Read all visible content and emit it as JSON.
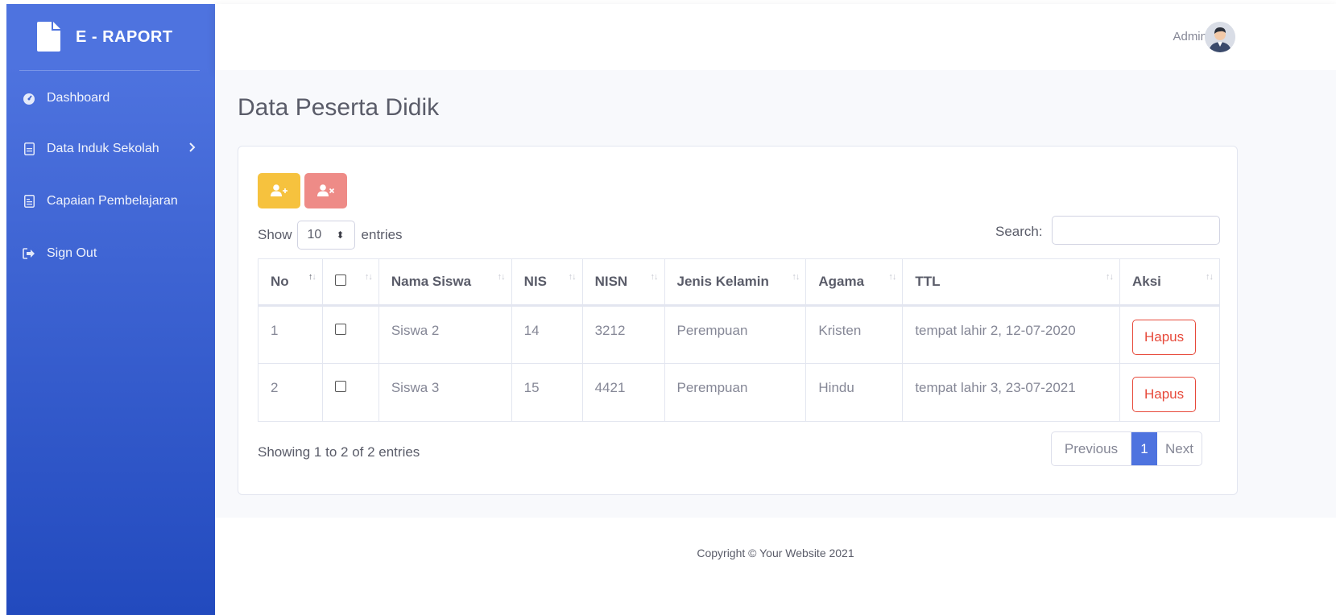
{
  "brand": {
    "name": "E - RAPORT",
    "icon": "file-icon"
  },
  "sidebar": {
    "items": [
      {
        "label": "Dashboard",
        "icon": "tachometer-icon"
      },
      {
        "label": "Data Induk Sekolah",
        "icon": "file-alt-icon",
        "has_submenu": true
      },
      {
        "label": "Capaian Pembelajaran",
        "icon": "file-alt-icon"
      },
      {
        "label": "Sign Out",
        "icon": "sign-out-icon"
      }
    ]
  },
  "topbar": {
    "user_name": "Admin"
  },
  "page": {
    "title": "Data Peserta Didik"
  },
  "toolbar": {
    "add_icon": "user-plus-icon",
    "delete_icon": "user-times-icon"
  },
  "table_controls": {
    "show_label": "Show",
    "entries_value": "10",
    "entries_label": "entries",
    "search_label": "Search:",
    "search_value": ""
  },
  "table": {
    "columns": [
      "No",
      "",
      "Nama Siswa",
      "NIS",
      "NISN",
      "Jenis Kelamin",
      "Agama",
      "TTL",
      "Aksi"
    ],
    "rows": [
      {
        "no": "1",
        "nama": "Siswa 2",
        "nis": "14",
        "nisn": "3212",
        "jk": "Perempuan",
        "agama": "Kristen",
        "ttl": "tempat lahir 2, 12-07-2020",
        "aksi": "Hapus"
      },
      {
        "no": "2",
        "nama": "Siswa 3",
        "nis": "15",
        "nisn": "4421",
        "jk": "Perempuan",
        "agama": "Hindu",
        "ttl": "tempat lahir 3, 23-07-2021",
        "aksi": "Hapus"
      }
    ]
  },
  "pagination": {
    "info": "Showing 1 to 2 of 2 entries",
    "previous": "Previous",
    "current": "1",
    "next": "Next"
  },
  "footer": {
    "text": "Copyright © Your Website 2021"
  },
  "colors": {
    "sidebar_start": "#4e73df",
    "sidebar_end": "#224abe",
    "warning": "#f6c23e",
    "danger": "#e74a3b",
    "primary": "#4e73df"
  }
}
